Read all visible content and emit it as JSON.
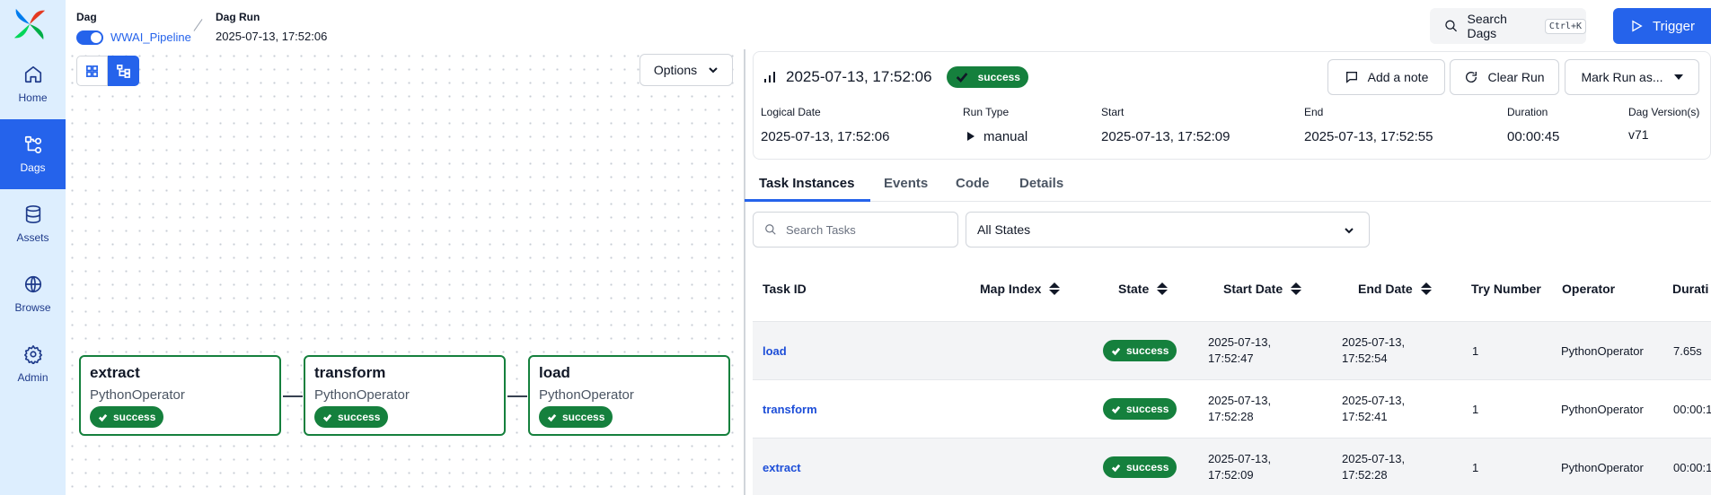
{
  "sidebar": {
    "logo": "airflow-logo",
    "items": [
      {
        "label": "Home",
        "icon": "home-icon"
      },
      {
        "label": "Dags",
        "icon": "dag-icon"
      },
      {
        "label": "Assets",
        "icon": "database-icon"
      },
      {
        "label": "Browse",
        "icon": "globe-icon"
      },
      {
        "label": "Admin",
        "icon": "gear-icon"
      }
    ],
    "active": "Dags"
  },
  "header": {
    "dag_title": "Dag",
    "dag_name": "WWAI_Pipeline",
    "run_title": "Dag Run",
    "run_value": "2025-07-13, 17:52:06",
    "search_label": "Search Dags",
    "search_shortcut": "Ctrl+K",
    "trigger_label": "Trigger"
  },
  "graph": {
    "options_label": "Options",
    "nodes": [
      {
        "name": "extract",
        "operator": "PythonOperator",
        "state": "success"
      },
      {
        "name": "transform",
        "operator": "PythonOperator",
        "state": "success"
      },
      {
        "name": "load",
        "operator": "PythonOperator",
        "state": "success"
      }
    ]
  },
  "run": {
    "title": "2025-07-13, 17:52:06",
    "state": "success",
    "add_note": "Add a note",
    "clear_run": "Clear Run",
    "mark_run": "Mark Run as...",
    "meta": {
      "logical_date_label": "Logical Date",
      "logical_date": "2025-07-13, 17:52:06",
      "run_type_label": "Run Type",
      "run_type": "manual",
      "start_label": "Start",
      "start": "2025-07-13, 17:52:09",
      "end_label": "End",
      "end": "2025-07-13, 17:52:55",
      "duration_label": "Duration",
      "duration": "00:00:45",
      "version_label": "Dag Version(s)",
      "version": "v71"
    }
  },
  "tabs": [
    "Task Instances",
    "Events",
    "Code",
    "Details"
  ],
  "filters": {
    "search_placeholder": "Search Tasks",
    "state_value": "All States"
  },
  "table": {
    "columns": [
      "Task ID",
      "Map Index",
      "State",
      "Start Date",
      "End Date",
      "Try Number",
      "Operator",
      "Durati"
    ],
    "rows": [
      {
        "task_id": "load",
        "state": "success",
        "start_1": "2025-07-13,",
        "start_2": "17:52:47",
        "end_1": "2025-07-13,",
        "end_2": "17:52:54",
        "try": "1",
        "operator": "PythonOperator",
        "duration": "7.65s"
      },
      {
        "task_id": "transform",
        "state": "success",
        "start_1": "2025-07-13,",
        "start_2": "17:52:28",
        "end_1": "2025-07-13,",
        "end_2": "17:52:41",
        "try": "1",
        "operator": "PythonOperator",
        "duration": "00:00:1"
      },
      {
        "task_id": "extract",
        "state": "success",
        "start_1": "2025-07-13,",
        "start_2": "17:52:09",
        "end_1": "2025-07-13,",
        "end_2": "17:52:28",
        "try": "1",
        "operator": "PythonOperator",
        "duration": "00:00:1"
      }
    ]
  },
  "colors": {
    "accent": "#2563eb",
    "success": "#15803d",
    "sidebar": "#ddeefe"
  }
}
